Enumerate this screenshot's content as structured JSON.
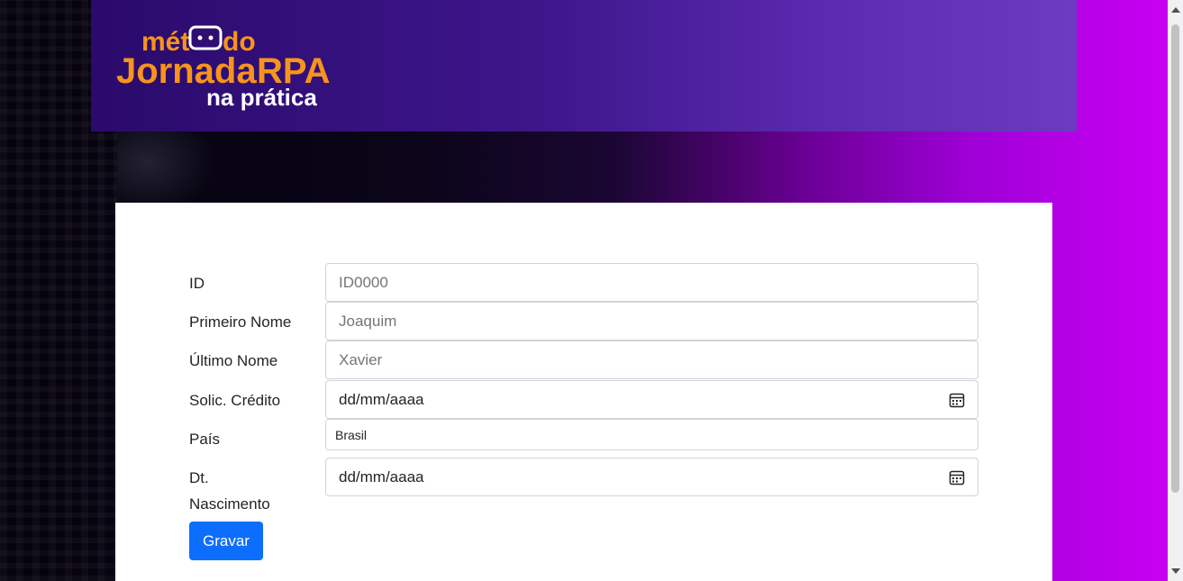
{
  "header": {
    "logo": {
      "line1_left": "mét",
      "line1_right": "do",
      "line2_left": "Jornada",
      "line2_right": "RPA",
      "line3": "na prática",
      "colors": {
        "orange": "#f7941d",
        "white": "#ffffff"
      }
    }
  },
  "form": {
    "fields": [
      {
        "label": "ID",
        "placeholder": "ID0000",
        "value": ""
      },
      {
        "label": "Primeiro Nome",
        "placeholder": "Joaquim",
        "value": ""
      },
      {
        "label": "Último Nome",
        "placeholder": "Xavier",
        "value": ""
      },
      {
        "label": "Solic. Crédito",
        "value": "dd/mm/aaaa",
        "icon": "calendar-icon"
      },
      {
        "label": "País",
        "value": "Brasil"
      },
      {
        "label_line1": "Dt.",
        "label_line2": "Nascimento",
        "value": "dd/mm/aaaa",
        "icon": "calendar-icon"
      }
    ],
    "submit_label": "Gravar"
  },
  "colors": {
    "primary_button": "#0d6efd",
    "header_gradient_start": "#2a0a6b",
    "header_gradient_end": "#6b3cbf",
    "background_accent": "#cc00f5"
  }
}
